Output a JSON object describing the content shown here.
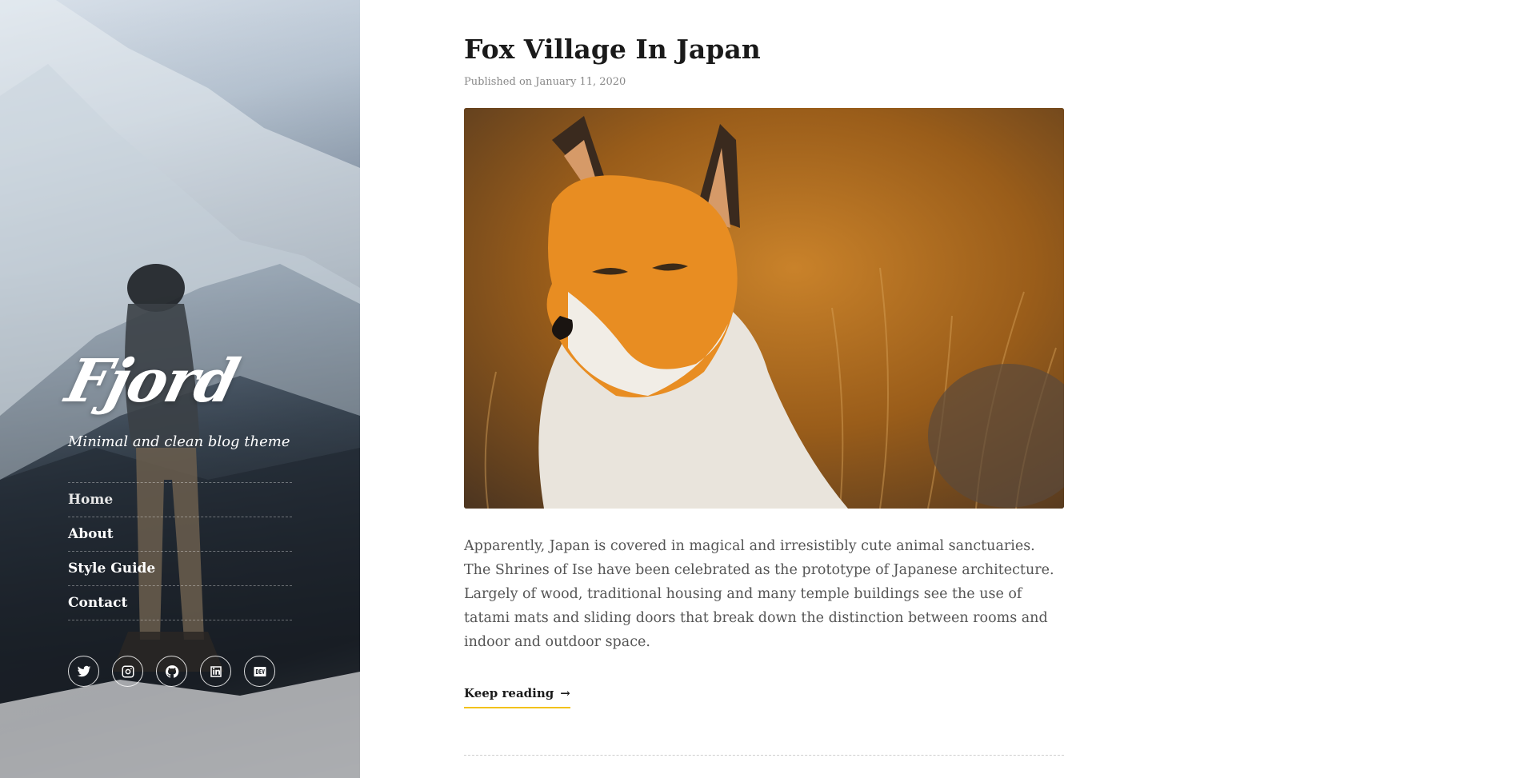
{
  "site": {
    "logo_text": "Fjord",
    "tagline": "Minimal and clean blog theme"
  },
  "nav": {
    "items": [
      {
        "label": "Home",
        "active": true
      },
      {
        "label": "About",
        "active": false
      },
      {
        "label": "Style Guide",
        "active": false
      },
      {
        "label": "Contact",
        "active": false
      }
    ]
  },
  "social": {
    "icons": [
      "twitter-icon",
      "instagram-icon",
      "github-icon",
      "linkedin-icon",
      "dev-icon"
    ]
  },
  "post": {
    "title": "Fox Village In Japan",
    "meta": "Published on January 11, 2020",
    "excerpt": "Apparently, Japan is covered in magical and irresistibly cute animal sanctuaries. The Shrines of Ise have been celebrated as the prototype of Japanese architecture. Largely of wood, traditional housing and many temple buildings see the use of tatami mats and sliding doors that break down the distinction between rooms and indoor and outdoor space.",
    "keep_reading": "Keep reading",
    "arrow": "→"
  },
  "colors": {
    "accent": "#f2c21b",
    "title": "#1a1a1a",
    "body_text": "#555555",
    "meta_text": "#888888"
  }
}
